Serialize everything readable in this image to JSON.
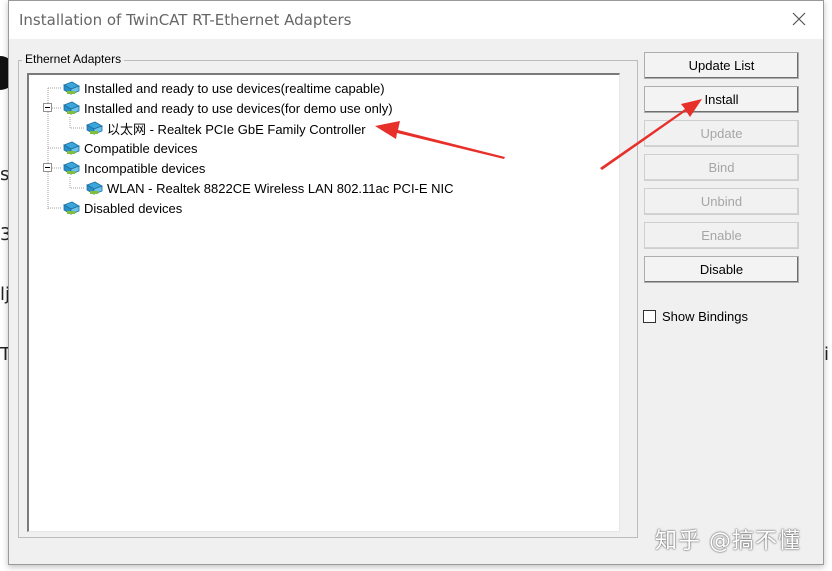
{
  "background_fragments": [
    "s",
    "3",
    "lj",
    "T",
    "i"
  ],
  "dialog": {
    "title": "Installation of TwinCAT RT-Ethernet Adapters",
    "group_label": "Ethernet Adapters"
  },
  "tree": {
    "nodes": [
      {
        "label": "Installed and ready to use devices(realtime capable)",
        "level": 0,
        "expanded": false
      },
      {
        "label": "Installed and ready to use devices(for demo use only)",
        "level": 0,
        "expanded": true
      },
      {
        "label": "以太网 - Realtek PCIe GbE Family Controller",
        "level": 1
      },
      {
        "label": "Compatible devices",
        "level": 0,
        "expanded": false
      },
      {
        "label": "Incompatible devices",
        "level": 0,
        "expanded": true
      },
      {
        "label": "WLAN - Realtek 8822CE Wireless LAN 802.11ac PCI-E NIC",
        "level": 1
      },
      {
        "label": "Disabled devices",
        "level": 0,
        "expanded": false
      }
    ]
  },
  "buttons": {
    "update_list": {
      "label": "Update List",
      "enabled": true
    },
    "install": {
      "label": "Install",
      "enabled": true
    },
    "update": {
      "label": "Update",
      "enabled": false
    },
    "bind": {
      "label": "Bind",
      "enabled": false
    },
    "unbind": {
      "label": "Unbind",
      "enabled": false
    },
    "enable": {
      "label": "Enable",
      "enabled": false
    },
    "disable": {
      "label": "Disable",
      "enabled": true
    }
  },
  "show_bindings": {
    "label": "Show Bindings",
    "checked": false
  },
  "annotation_color": "#e8302a",
  "watermark": "知乎 @搞不懂",
  "icons": {
    "close": "close-icon",
    "network_adapter": "network-adapter-icon"
  }
}
